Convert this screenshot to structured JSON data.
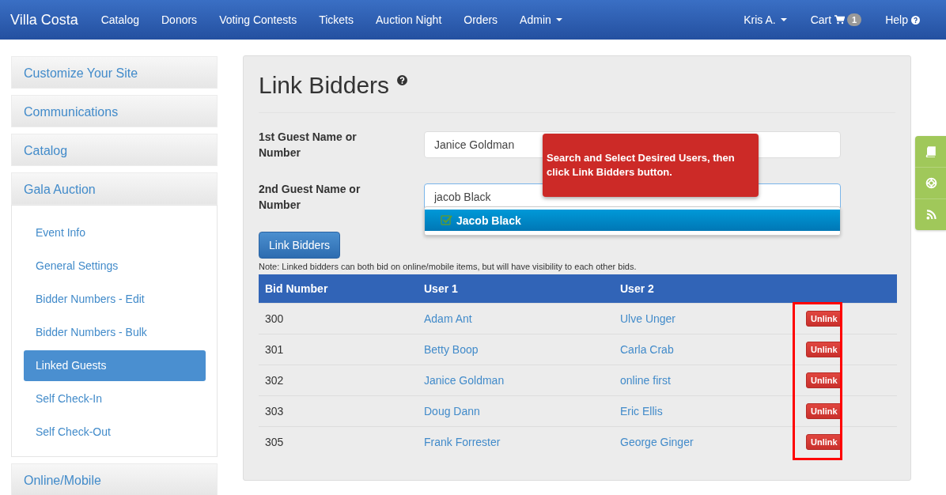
{
  "navbar": {
    "brand": "Villa Costa",
    "items": [
      {
        "label": "Catalog",
        "caret": false
      },
      {
        "label": "Donors",
        "caret": false
      },
      {
        "label": "Voting Contests",
        "caret": false
      },
      {
        "label": "Tickets",
        "caret": false
      },
      {
        "label": "Auction Night",
        "caret": false
      },
      {
        "label": "Orders",
        "caret": false
      },
      {
        "label": "Admin",
        "caret": true
      }
    ],
    "user": {
      "label": "Kris A.",
      "caret": true
    },
    "cart": {
      "label": "Cart",
      "badge": "1"
    },
    "help": {
      "label": "Help"
    }
  },
  "sidebar": {
    "sections": [
      {
        "label": "Customize Your Site",
        "expanded": false
      },
      {
        "label": "Communications",
        "expanded": false
      },
      {
        "label": "Catalog",
        "expanded": false
      },
      {
        "label": "Gala Auction",
        "expanded": true,
        "items": [
          {
            "label": "Event Info",
            "selected": false
          },
          {
            "label": "General Settings",
            "selected": false
          },
          {
            "label": "Bidder Numbers - Edit",
            "selected": false
          },
          {
            "label": "Bidder Numbers - Bulk",
            "selected": false
          },
          {
            "label": "Linked Guests",
            "selected": true
          },
          {
            "label": "Self Check-In",
            "selected": false
          },
          {
            "label": "Self Check-Out",
            "selected": false
          }
        ]
      },
      {
        "label": "Online/Mobile",
        "expanded": false
      }
    ]
  },
  "main": {
    "title": "Link Bidders",
    "fields": [
      {
        "label": "1st Guest Name or Number",
        "value": "Janice Goldman",
        "focused": false
      },
      {
        "label": "2nd Guest Name or Number",
        "value": "jacob Black",
        "focused": true
      }
    ],
    "suggestion": {
      "label": "Jacob Black",
      "checked": true
    },
    "tooltip": "Search and Select Desired Users, then click Link Bidders button.",
    "button": "Link Bidders",
    "note": "Note: Linked bidders can both bid on online/mobile items, but will have visibility to each other bids.",
    "table": {
      "columns": [
        "Bid Number",
        "User 1",
        "User 2"
      ],
      "rows": [
        {
          "bid": "300",
          "user1": "Adam Ant",
          "user2": "Ulve Unger",
          "action": "Unlink"
        },
        {
          "bid": "301",
          "user1": "Betty Boop",
          "user2": "Carla Crab",
          "action": "Unlink"
        },
        {
          "bid": "302",
          "user1": "Janice Goldman",
          "user2": "online first",
          "action": "Unlink"
        },
        {
          "bid": "303",
          "user1": "Doug Dann",
          "user2": "Eric Ellis",
          "action": "Unlink"
        },
        {
          "bid": "305",
          "user1": "Frank Forrester",
          "user2": "George Ginger",
          "action": "Unlink"
        }
      ]
    }
  }
}
